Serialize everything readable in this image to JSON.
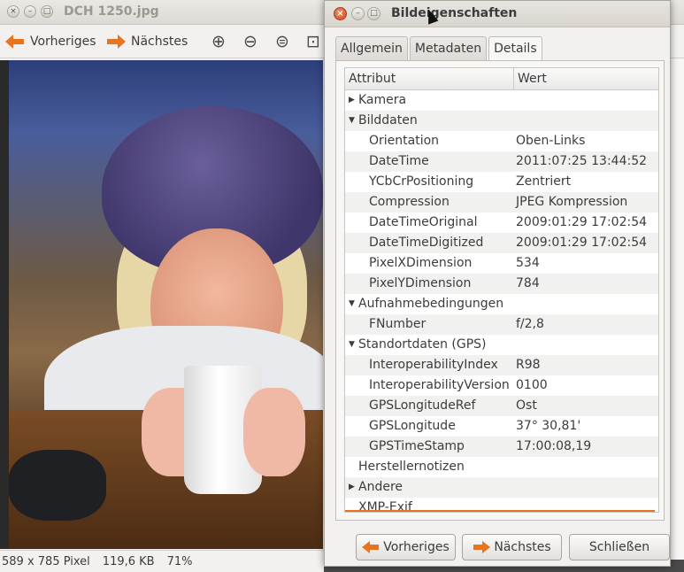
{
  "viewer": {
    "title": "DCH 1250.jpg",
    "toolbar": {
      "prev_label": "Vorheriges",
      "next_label": "Nächstes",
      "icons": [
        "zoom-in-icon",
        "zoom-out-icon",
        "zoom-normal-icon",
        "zoom-fit-icon"
      ]
    },
    "status": {
      "dimensions": "589 x 785 Pixel",
      "size": "119,6 KB",
      "zoom": "71%"
    }
  },
  "dialog": {
    "title": "Bildeigenschaften",
    "tabs": [
      {
        "label": "Allgemein",
        "active": false
      },
      {
        "label": "Metadaten",
        "active": false
      },
      {
        "label": "Details",
        "active": true
      }
    ],
    "columns": {
      "attribute": "Attribut",
      "value": "Wert"
    },
    "rows": [
      {
        "level": 0,
        "expander": "collapsed",
        "attr": "Kamera",
        "value": ""
      },
      {
        "level": 0,
        "expander": "expanded",
        "attr": "Bilddaten",
        "value": ""
      },
      {
        "level": 1,
        "expander": "",
        "attr": "Orientation",
        "value": "Oben-Links"
      },
      {
        "level": 1,
        "expander": "",
        "attr": "DateTime",
        "value": "2011:07:25 13:44:52"
      },
      {
        "level": 1,
        "expander": "",
        "attr": "YCbCrPositioning",
        "value": "Zentriert"
      },
      {
        "level": 1,
        "expander": "",
        "attr": "Compression",
        "value": "JPEG Kompression"
      },
      {
        "level": 1,
        "expander": "",
        "attr": "DateTimeOriginal",
        "value": "2009:01:29 17:02:54"
      },
      {
        "level": 1,
        "expander": "",
        "attr": "DateTimeDigitized",
        "value": "2009:01:29 17:02:54"
      },
      {
        "level": 1,
        "expander": "",
        "attr": "PixelXDimension",
        "value": "534"
      },
      {
        "level": 1,
        "expander": "",
        "attr": "PixelYDimension",
        "value": "784"
      },
      {
        "level": 0,
        "expander": "expanded",
        "attr": "Aufnahmebedingungen",
        "value": ""
      },
      {
        "level": 1,
        "expander": "",
        "attr": "FNumber",
        "value": "f/2,8"
      },
      {
        "level": 0,
        "expander": "expanded",
        "attr": "Standortdaten (GPS)",
        "value": ""
      },
      {
        "level": 1,
        "expander": "",
        "attr": "InteroperabilityIndex",
        "value": "R98"
      },
      {
        "level": 1,
        "expander": "",
        "attr": "InteroperabilityVersion",
        "value": "0100"
      },
      {
        "level": 1,
        "expander": "",
        "attr": "GPSLongitudeRef",
        "value": "Ost"
      },
      {
        "level": 1,
        "expander": "",
        "attr": "GPSLongitude",
        "value": "37° 30,81'"
      },
      {
        "level": 1,
        "expander": "",
        "attr": "GPSTimeStamp",
        "value": "17:00:08,19"
      },
      {
        "level": 0,
        "expander": "",
        "attr": "Herstellernotizen",
        "value": ""
      },
      {
        "level": 0,
        "expander": "collapsed",
        "attr": "Andere",
        "value": ""
      },
      {
        "level": 0,
        "expander": "",
        "attr": "XMP-Exif",
        "value": ""
      }
    ],
    "buttons": {
      "prev": "Vorheriges",
      "next": "Nächstes",
      "close": "Schließen"
    }
  },
  "colors": {
    "accent": "#e8741f",
    "close_button": "#d6491c"
  }
}
